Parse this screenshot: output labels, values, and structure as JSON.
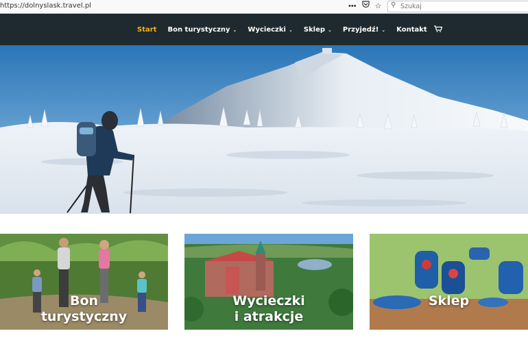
{
  "browser": {
    "url": "https://dolnyslask.travel.pl",
    "search_placeholder": "Szukaj",
    "icons": [
      "more-icon",
      "pocket-icon",
      "bookmark-star-icon",
      "search-icon"
    ]
  },
  "nav": {
    "items": [
      {
        "label": "Start",
        "active": true
      },
      {
        "label": "Bon turystyczny",
        "dropdown": true
      },
      {
        "label": "Wycieczki",
        "dropdown": true
      },
      {
        "label": "Sklep",
        "dropdown": true
      },
      {
        "label": "Przyjedź!",
        "dropdown": true
      },
      {
        "label": "Kontakt",
        "dropdown": false
      }
    ],
    "cart_icon": "cart-icon",
    "colors": {
      "background": "#1e2a2f",
      "active": "#f5b21b",
      "text": "#ffffff"
    }
  },
  "hero": {
    "image": "winter-mountain-hiker"
  },
  "cards": [
    {
      "title_line1": "Bon",
      "title_line2": "turystyczny",
      "image": "family-hiking"
    },
    {
      "title_line1": "Wycieczki",
      "title_line2": "i atrakcje",
      "image": "castle-aerial"
    },
    {
      "title_line1": "Sklep",
      "title_line2": "",
      "image": "pottery"
    }
  ]
}
